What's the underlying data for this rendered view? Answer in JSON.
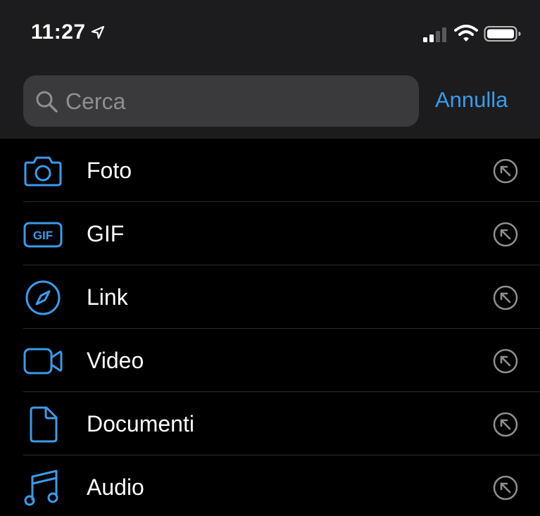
{
  "status_bar": {
    "time": "11:27"
  },
  "search": {
    "placeholder": "Cerca",
    "cancel_label": "Annulla"
  },
  "colors": {
    "accent": "#3a9bea",
    "background": "#000000",
    "header_background": "#1c1c1e",
    "search_field": "#3a3a3c",
    "placeholder": "#8e8e93",
    "divider": "#2c2c2e",
    "arrow": "#8e8e93"
  },
  "items": [
    {
      "label": "Foto",
      "icon": "camera-icon"
    },
    {
      "label": "GIF",
      "icon": "gif-icon",
      "icon_text": "GIF"
    },
    {
      "label": "Link",
      "icon": "compass-icon"
    },
    {
      "label": "Video",
      "icon": "video-camera-icon"
    },
    {
      "label": "Documenti",
      "icon": "document-icon"
    },
    {
      "label": "Audio",
      "icon": "music-note-icon"
    }
  ]
}
